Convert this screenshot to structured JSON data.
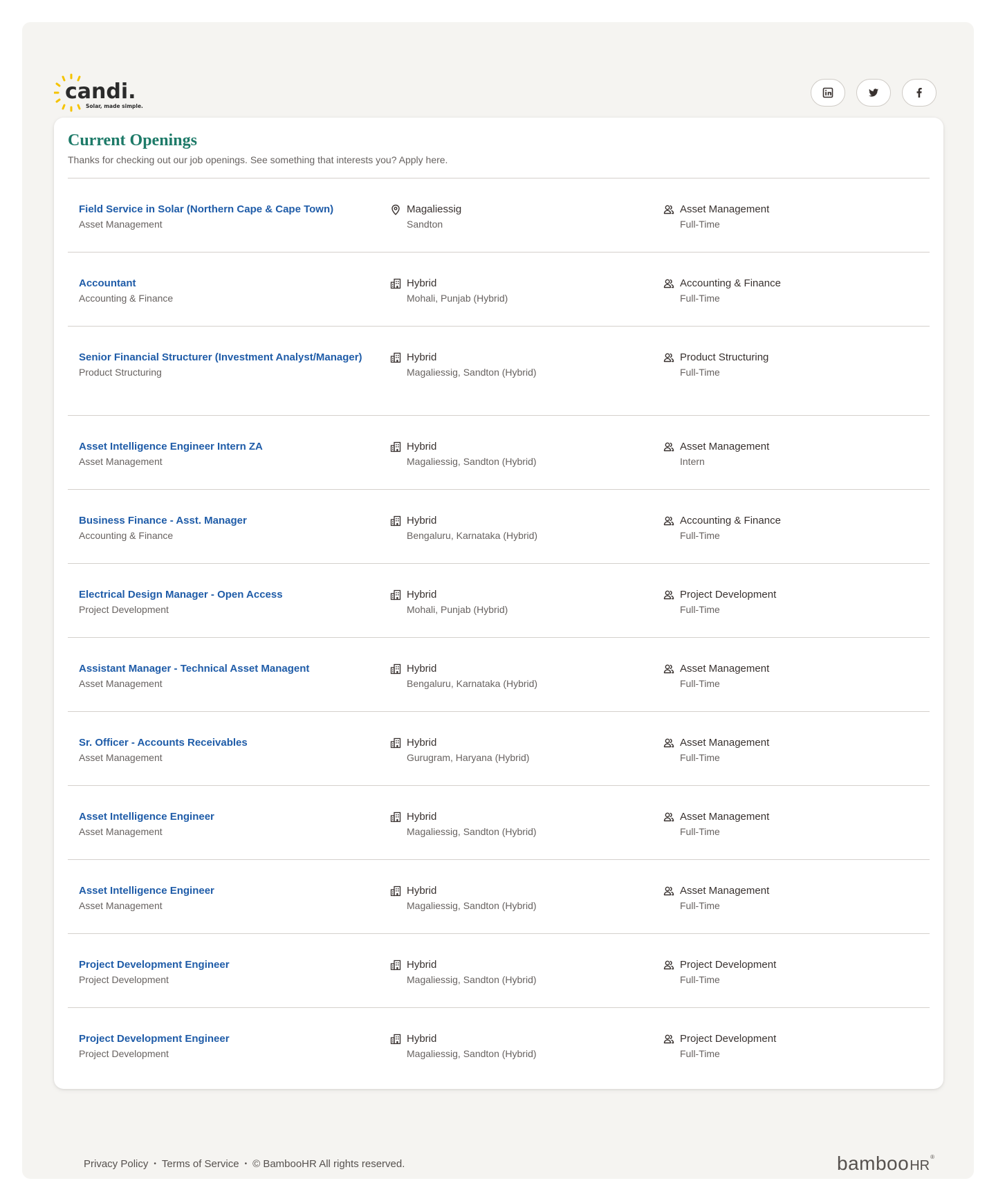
{
  "header": {
    "logo_text": "candi.",
    "logo_tagline": "Solar, made simple.",
    "social": [
      {
        "icon": "linkedin-icon"
      },
      {
        "icon": "twitter-icon"
      },
      {
        "icon": "facebook-icon"
      }
    ]
  },
  "openings": {
    "title": "Current Openings",
    "subtitle": "Thanks for checking out our job openings. See something that interests you? Apply here.",
    "jobs": [
      {
        "title": "Field Service in Solar (Northern Cape & Cape Town)",
        "department": "Asset Management",
        "location_type": "Magaliessig",
        "location": "Sandton",
        "location_icon": "map-pin-icon",
        "team": "Asset Management",
        "employment": "Full-Time"
      },
      {
        "title": "Accountant",
        "department": "Accounting & Finance",
        "location_type": "Hybrid",
        "location": "Mohali, Punjab (Hybrid)",
        "location_icon": "building-icon",
        "team": "Accounting & Finance",
        "employment": "Full-Time"
      },
      {
        "title": "Senior Financial Structurer (Investment Analyst/Manager)",
        "department": "Product Structuring",
        "location_type": "Hybrid",
        "location": "Magaliessig, Sandton (Hybrid)",
        "location_icon": "building-icon",
        "team": "Product Structuring",
        "employment": "Full-Time"
      },
      {
        "title": "Asset Intelligence Engineer Intern ZA",
        "department": "Asset Management",
        "location_type": "Hybrid",
        "location": "Magaliessig, Sandton (Hybrid)",
        "location_icon": "building-icon",
        "team": "Asset Management",
        "employment": "Intern"
      },
      {
        "title": "Business Finance - Asst. Manager",
        "department": "Accounting & Finance",
        "location_type": "Hybrid",
        "location": "Bengaluru, Karnataka (Hybrid)",
        "location_icon": "building-icon",
        "team": "Accounting & Finance",
        "employment": "Full-Time"
      },
      {
        "title": "Electrical Design Manager - Open Access",
        "department": "Project Development",
        "location_type": "Hybrid",
        "location": "Mohali, Punjab (Hybrid)",
        "location_icon": "building-icon",
        "team": "Project Development",
        "employment": "Full-Time"
      },
      {
        "title": "Assistant Manager - Technical Asset Managent",
        "department": "Asset Management",
        "location_type": "Hybrid",
        "location": "Bengaluru, Karnataka (Hybrid)",
        "location_icon": "building-icon",
        "team": "Asset Management",
        "employment": "Full-Time"
      },
      {
        "title": "Sr. Officer - Accounts Receivables",
        "department": "Asset Management",
        "location_type": "Hybrid",
        "location": "Gurugram, Haryana (Hybrid)",
        "location_icon": "building-icon",
        "team": "Asset Management",
        "employment": "Full-Time"
      },
      {
        "title": "Asset Intelligence Engineer",
        "department": "Asset Management",
        "location_type": "Hybrid",
        "location": "Magaliessig, Sandton (Hybrid)",
        "location_icon": "building-icon",
        "team": "Asset Management",
        "employment": "Full-Time"
      },
      {
        "title": "Asset Intelligence Engineer",
        "department": "Asset Management",
        "location_type": "Hybrid",
        "location": "Magaliessig, Sandton (Hybrid)",
        "location_icon": "building-icon",
        "team": "Asset Management",
        "employment": "Full-Time"
      },
      {
        "title": "Project Development Engineer",
        "department": "Project Development",
        "location_type": "Hybrid",
        "location": "Magaliessig, Sandton (Hybrid)",
        "location_icon": "building-icon",
        "team": "Project Development",
        "employment": "Full-Time"
      },
      {
        "title": "Project Development Engineer",
        "department": "Project Development",
        "location_type": "Hybrid",
        "location": "Magaliessig, Sandton (Hybrid)",
        "location_icon": "building-icon",
        "team": "Project Development",
        "employment": "Full-Time"
      }
    ]
  },
  "footer": {
    "privacy": "Privacy Policy",
    "separator": "•",
    "terms": "Terms of Service",
    "copyright": "© BambooHR All rights reserved.",
    "brand_main": "bamboo",
    "brand_hr": "HR",
    "brand_mark": "®"
  },
  "colors": {
    "title": "#1d7a68",
    "link": "#1f5ca8",
    "logo_sun": "#f5c300",
    "logo_text": "#2b2b2b",
    "background": "#f5f4f1"
  }
}
